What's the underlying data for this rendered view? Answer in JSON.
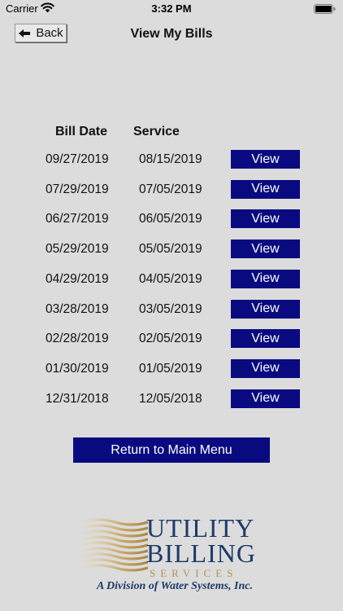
{
  "status": {
    "carrier": "Carrier",
    "time": "3:32 PM"
  },
  "header": {
    "back_label": "Back",
    "title": "View My Bills"
  },
  "table": {
    "headers": {
      "bill_date": "Bill Date",
      "service": "Service"
    },
    "view_label": "View",
    "rows": [
      {
        "bill_date": "09/27/2019",
        "service": "08/15/2019"
      },
      {
        "bill_date": "07/29/2019",
        "service": "07/05/2019"
      },
      {
        "bill_date": "06/27/2019",
        "service": "06/05/2019"
      },
      {
        "bill_date": "05/29/2019",
        "service": "05/05/2019"
      },
      {
        "bill_date": "04/29/2019",
        "service": "04/05/2019"
      },
      {
        "bill_date": "03/28/2019",
        "service": "03/05/2019"
      },
      {
        "bill_date": "02/28/2019",
        "service": "02/05/2019"
      },
      {
        "bill_date": "01/30/2019",
        "service": "01/05/2019"
      },
      {
        "bill_date": "12/31/2018",
        "service": "12/05/2018"
      }
    ]
  },
  "footer": {
    "main_menu_label": "Return to Main Menu"
  },
  "logo": {
    "line1": "UTILITY",
    "line2": "BILLING",
    "line3": "SERVICES",
    "tagline": "A Division of Water Systems, Inc."
  },
  "colors": {
    "button": "#0a0a80",
    "background": "#dcdcdc",
    "logo_blue": "#1d3a68",
    "logo_gold": "#b29350"
  }
}
